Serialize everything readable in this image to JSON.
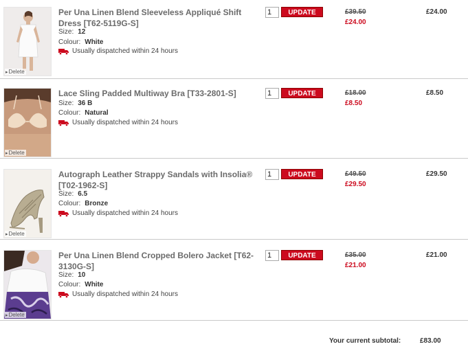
{
  "cart": {
    "items": [
      {
        "title": "Per Una Linen Blend Sleeveless Appliqué Shift Dress [T62-5119G-S]",
        "size_label": "Size:",
        "size": "12",
        "colour_label": "Colour:",
        "colour": "White",
        "dispatch": "Usually dispatched within 24 hours",
        "qty": "1",
        "update_label": "UPDATE",
        "was_price": "£39.50",
        "now_price": "£24.00",
        "line_total": "£24.00",
        "delete_label": "Delete"
      },
      {
        "title": "Lace Sling Padded Multiway Bra [T33-2801-S]",
        "size_label": "Size:",
        "size": "36 B",
        "colour_label": "Colour:",
        "colour": "Natural",
        "dispatch": "Usually dispatched within 24 hours",
        "qty": "1",
        "update_label": "UPDATE",
        "was_price": "£18.00",
        "now_price": "£8.50",
        "line_total": "£8.50",
        "delete_label": "Delete"
      },
      {
        "title": "Autograph Leather Strappy Sandals with Insolia® [T02-1962-S]",
        "size_label": "Size:",
        "size": "6.5",
        "colour_label": "Colour:",
        "colour": "Bronze",
        "dispatch": "Usually dispatched within 24 hours",
        "qty": "1",
        "update_label": "UPDATE",
        "was_price": "£49.50",
        "now_price": "£29.50",
        "line_total": "£29.50",
        "delete_label": "Delete"
      },
      {
        "title": "Per Una Linen Blend Cropped Bolero Jacket [T62-3130G-S]",
        "size_label": "Size:",
        "size": "10",
        "colour_label": "Colour:",
        "colour": "White",
        "dispatch": "Usually dispatched within 24 hours",
        "qty": "1",
        "update_label": "UPDATE",
        "was_price": "£35.00",
        "now_price": "£21.00",
        "line_total": "£21.00",
        "delete_label": "Delete"
      }
    ],
    "subtotal_label": "Your current subtotal:",
    "subtotal": "£83.00"
  },
  "colors": {
    "accent": "#cc0a1e",
    "muted_title": "#6b6b6b",
    "separator": "#c9c9c9"
  },
  "icons": {
    "dispatch": "delivery-truck-icon",
    "delete": "arrow-right-icon"
  }
}
